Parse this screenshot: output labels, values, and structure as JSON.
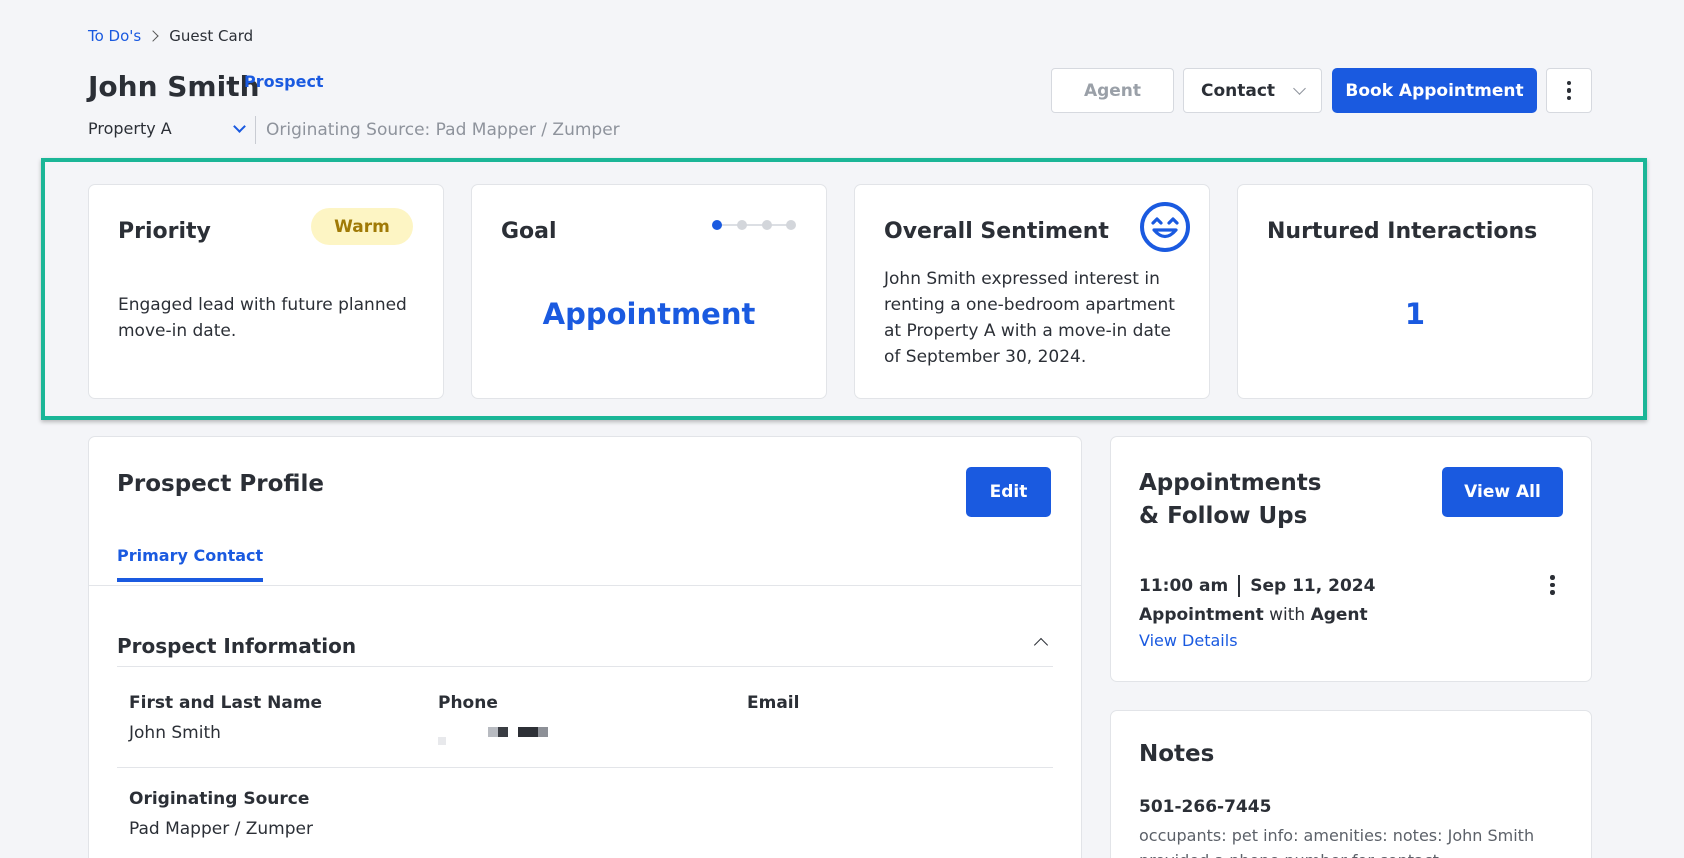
{
  "breadcrumb": {
    "parent": "To Do's",
    "current": "Guest Card"
  },
  "header": {
    "name": "John Smith",
    "status_badge": "Prospect",
    "property_select": "Property A",
    "originating_source": "Originating Source: Pad Mapper / Zumper",
    "agent_label": "Agent",
    "contact_label": "Contact",
    "book_label": "Book Appointment"
  },
  "kpis": {
    "priority": {
      "title": "Priority",
      "badge": "Warm",
      "description": "Engaged lead with future planned move-in date."
    },
    "goal": {
      "title": "Goal",
      "value": "Appointment",
      "steps_total": 4,
      "steps_done": 1
    },
    "sentiment": {
      "title": "Overall Sentiment",
      "icon": "smiling-face-icon",
      "summary": "John Smith expressed interest in renting a one-bedroom apartment at Property A with a move-in date of September 30, 2024."
    },
    "nurtured": {
      "title": "Nurtured Interactions",
      "value": "1"
    }
  },
  "profile": {
    "title": "Prospect Profile",
    "edit_label": "Edit",
    "tab": "Primary Contact",
    "section_title": "Prospect Information",
    "fields": {
      "name_label": "First and Last Name",
      "name_value": "John Smith",
      "phone_label": "Phone",
      "email_label": "Email",
      "source_label": "Originating Source",
      "source_value": "Pad Mapper / Zumper"
    }
  },
  "appointments": {
    "title_line1": "Appointments",
    "title_line2": "& Follow Ups",
    "view_all_label": "View All",
    "item": {
      "time": "11:00 am",
      "date": "Sep 11, 2024",
      "type": "Appointment",
      "with_word": " with ",
      "with": "Agent",
      "details_link": "View Details"
    }
  },
  "notes": {
    "title": "Notes",
    "phone": "501-266-7445",
    "text": "occupants: pet info: amenities: notes: John Smith provided a phone number for contact."
  },
  "colors": {
    "accent": "#1a5ae0",
    "highlight_frame": "#1bb697",
    "warm_bg": "#fdf5c4",
    "warm_text": "#a07a06"
  }
}
